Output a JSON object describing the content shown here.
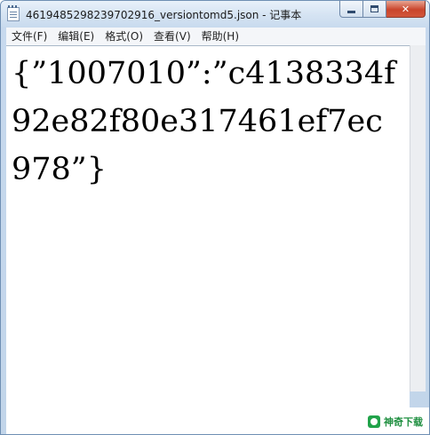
{
  "window": {
    "title": "4619485298239702916_versiontomd5.json - 记事本"
  },
  "menu": {
    "items": [
      {
        "label": "文件(F)"
      },
      {
        "label": "编辑(E)"
      },
      {
        "label": "格式(O)"
      },
      {
        "label": "查看(V)"
      },
      {
        "label": "帮助(H)"
      }
    ]
  },
  "editor": {
    "content": "{”1007010”:”c4138334f92e82f80e317461ef7ec978”}"
  },
  "watermark": {
    "text": "神奇下载"
  },
  "icons": {
    "app": "notepad-icon",
    "minimize": "minimize-icon",
    "maximize": "maximize-icon",
    "close": "close-icon"
  }
}
